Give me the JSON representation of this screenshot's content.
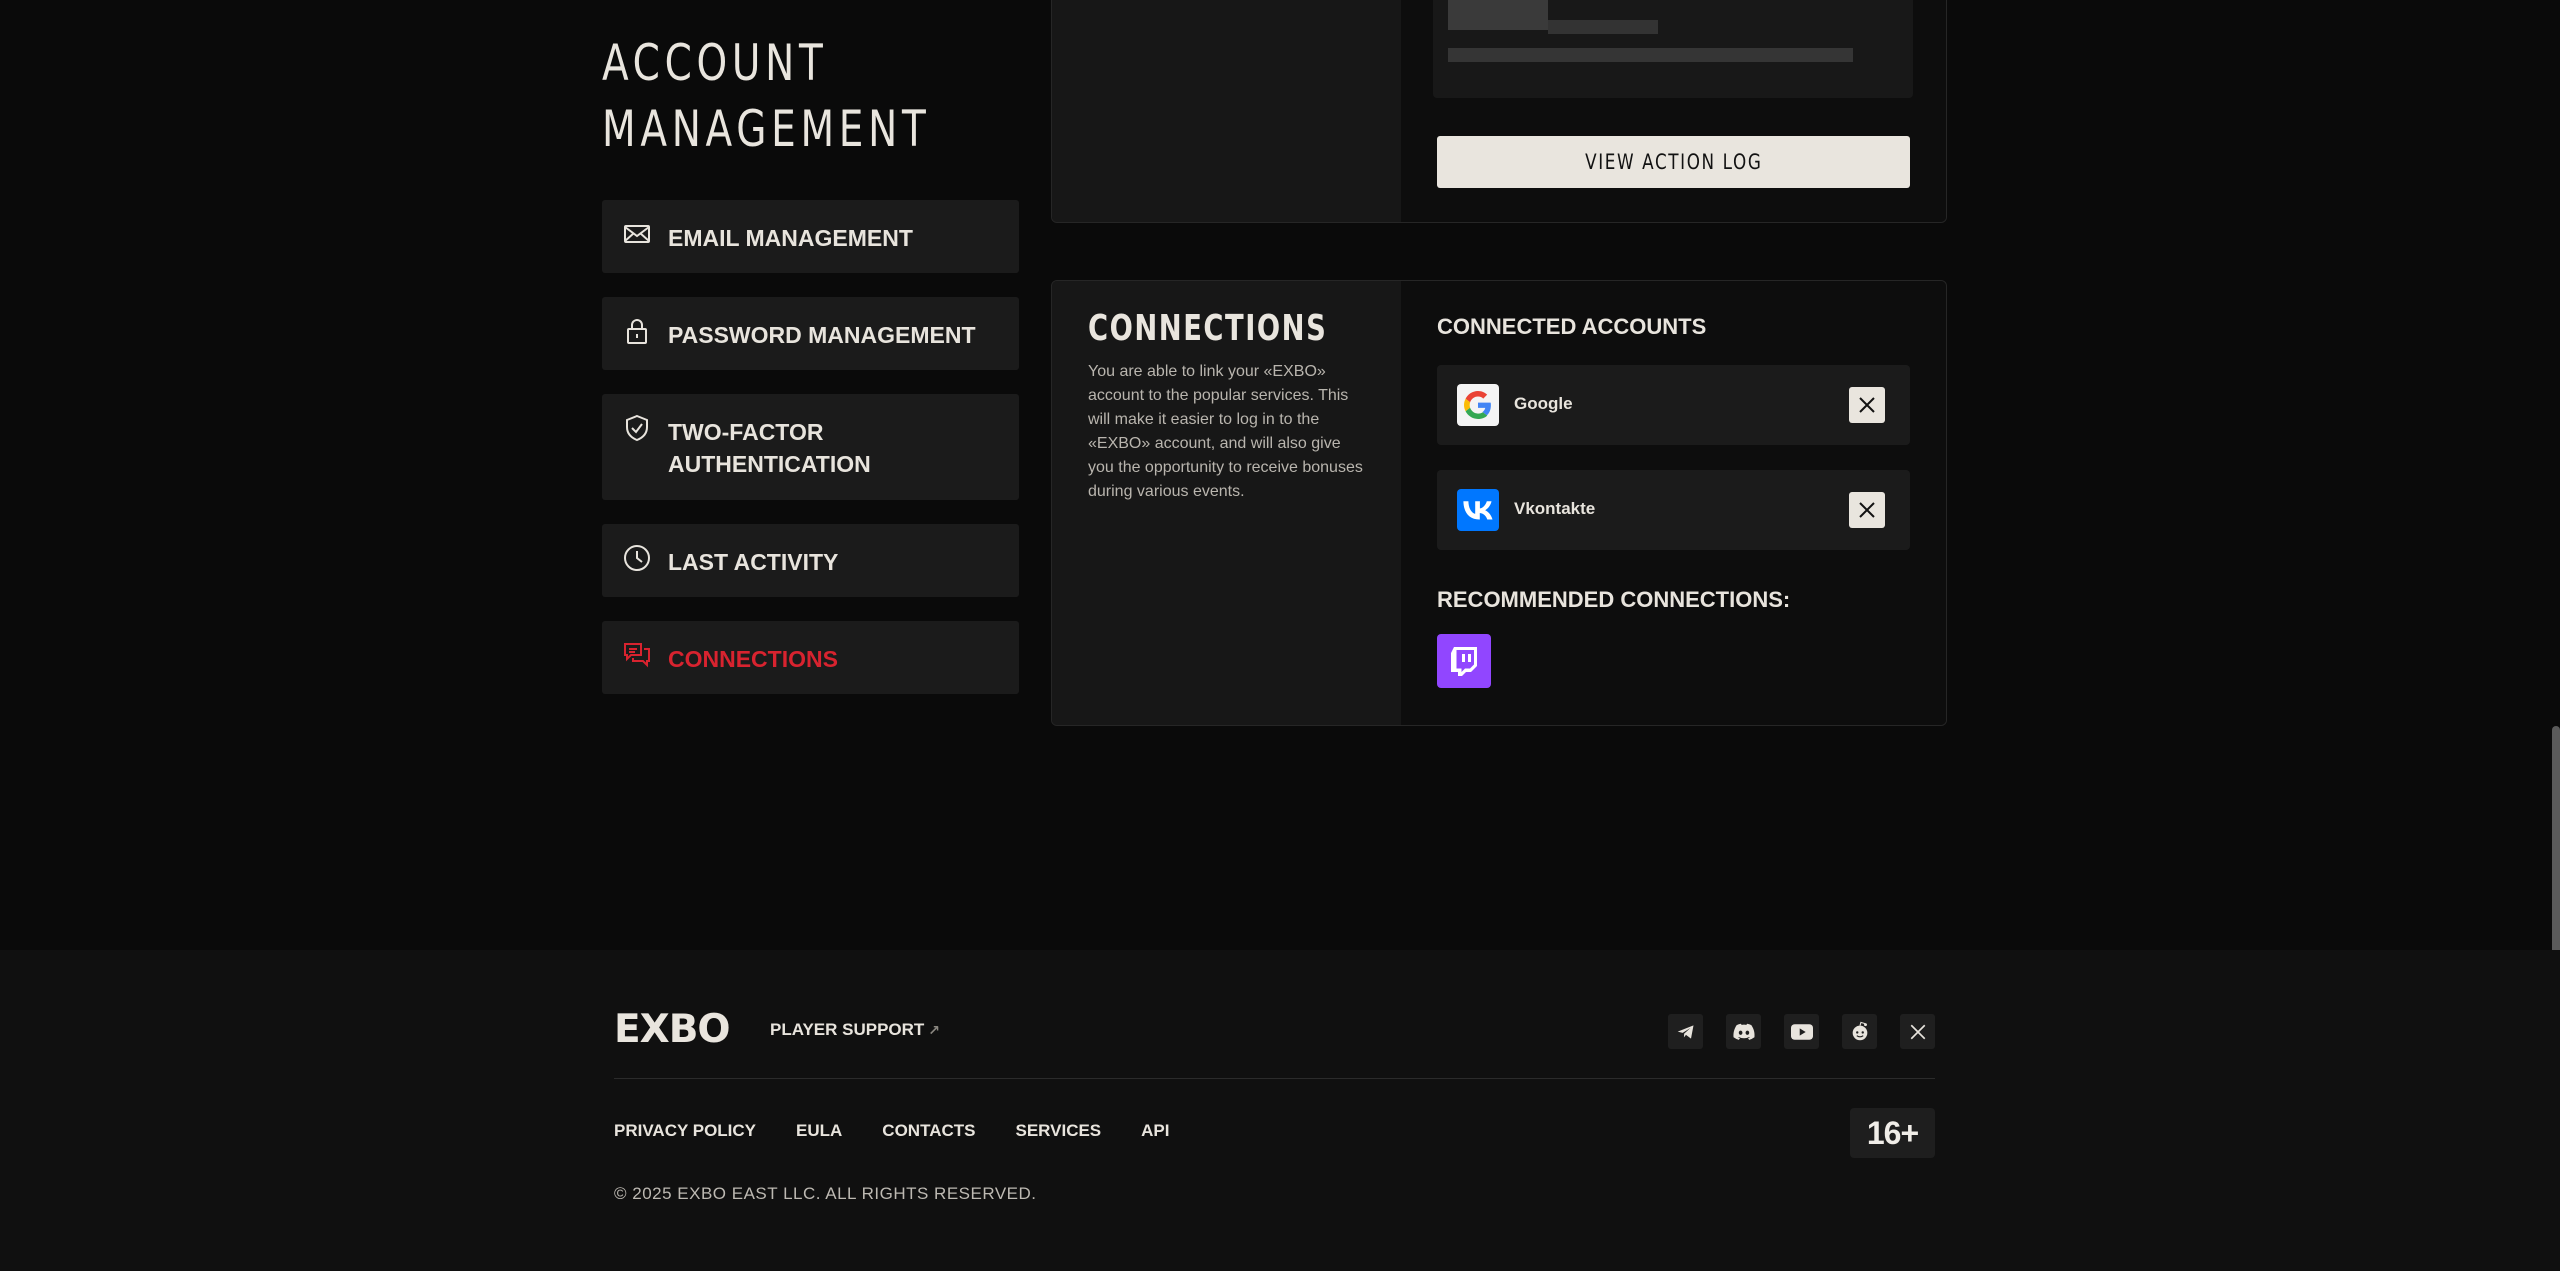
{
  "page": {
    "title_line1": "ACCOUNT",
    "title_line2": "MANAGEMENT"
  },
  "nav": {
    "items": [
      {
        "label": "EMAIL MANAGEMENT",
        "icon": "envelope-icon"
      },
      {
        "label": "PASSWORD MANAGEMENT",
        "icon": "lock-icon"
      },
      {
        "label_line1": "TWO-FACTOR",
        "label_line2": "AUTHENTICATION",
        "icon": "shield-check-icon"
      },
      {
        "label": "LAST ACTIVITY",
        "icon": "clock-icon"
      },
      {
        "label": "CONNECTIONS",
        "icon": "chat-icon",
        "active": true
      }
    ],
    "active_color": "#d8232f"
  },
  "action_log": {
    "button_label": "VIEW ACTION LOG"
  },
  "connections": {
    "title": "CONNECTIONS",
    "description": "You are able to link your «EXBO» account to the popular services. This will make it easier to log in to the «EXBO» account, and will also give you the opportunity to receive bonuses during various events.",
    "connected_title": "CONNECTED ACCOUNTS",
    "accounts": [
      {
        "name": "Google",
        "icon": "google-icon"
      },
      {
        "name": "Vkontakte",
        "icon": "vk-icon",
        "color": "#0077ff"
      }
    ],
    "recommended_title": "RECOMMENDED CONNECTIONS:",
    "recommended": [
      {
        "icon": "twitch-icon",
        "color": "#9146ff"
      }
    ]
  },
  "footer": {
    "brand": "EXBO",
    "support_label": "PLAYER SUPPORT",
    "socials": [
      "telegram-icon",
      "discord-icon",
      "youtube-icon",
      "reddit-icon",
      "x-icon"
    ],
    "links": [
      "PRIVACY POLICY",
      "EULA",
      "CONTACTS",
      "SERVICES",
      "API"
    ],
    "copyright": "© 2025 EXBO EAST LLC. ALL RIGHTS RESERVED.",
    "age_rating": "16+"
  }
}
